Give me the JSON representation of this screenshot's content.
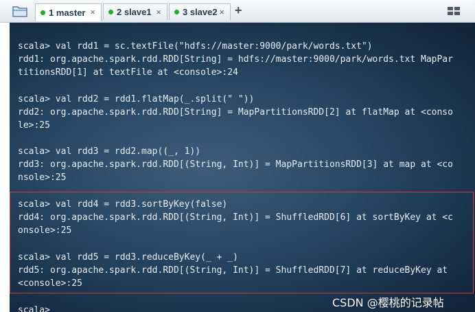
{
  "tabs": [
    {
      "label": "1 master",
      "close": "×",
      "status_color": "#17b317"
    },
    {
      "label": "2 slave1",
      "close": "×",
      "status_color": "#17b317"
    },
    {
      "label": "3 slave2",
      "close": "×",
      "status_color": "#17b317"
    }
  ],
  "add_tab": "+",
  "icons": {
    "folder": "folder-icon",
    "layout": "layout-grid-icon"
  },
  "terminal": {
    "lines": [
      "scala> val rdd1 = sc.textFile(\"hdfs://master:9000/park/words.txt\")",
      "rdd1: org.apache.spark.rdd.RDD[String] = hdfs://master:9000/park/words.txt MapPar",
      "titionsRDD[1] at textFile at <console>:24",
      "scala> val rdd2 = rdd1.flatMap(_.split(\" \"))",
      "rdd2: org.apache.spark.rdd.RDD[String] = MapPartitionsRDD[2] at flatMap at <conso",
      "le>:25",
      "scala> val rdd3 = rdd2.map((_, 1))",
      "rdd3: org.apache.spark.rdd.RDD[(String, Int)] = MapPartitionsRDD[3] at map at <co",
      "nsole>:25",
      "scala> val rdd4 = rdd3.sortByKey(false)",
      "rdd4: org.apache.spark.rdd.RDD[(String, Int)] = ShuffledRDD[6] at sortByKey at <c",
      "onsole>:25",
      "scala> val rdd5 = rdd3.reduceByKey(_ + _)",
      "rdd5: org.apache.spark.rdd.RDD[(String, Int)] = ShuffledRDD[7] at reduceByKey at",
      "<console>:25",
      "scala>"
    ]
  },
  "watermark": "CSDN @樱桃的记录帖",
  "colors": {
    "highlight": "#d23a3a",
    "status": "#17b317"
  }
}
